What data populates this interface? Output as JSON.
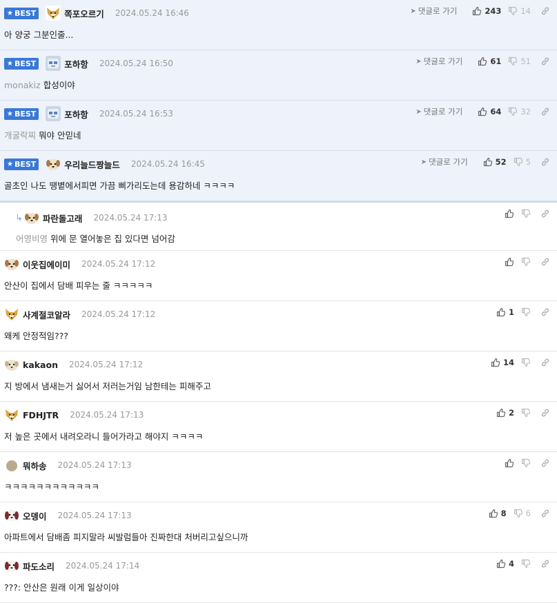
{
  "best_label": "BEST",
  "goto_label": "댓글로 가기",
  "comments": [
    {
      "nick": "쪽포오르기",
      "date": "2024.05.24 16:46",
      "prefix": "",
      "text": "아 양궁 그분인줄...",
      "up": "243",
      "down": "14",
      "best": true,
      "avatar": "fox"
    },
    {
      "nick": "포하항",
      "date": "2024.05.24 16:50",
      "prefix": "monakiz",
      "text": "합성이야",
      "up": "61",
      "down": "51",
      "best": true,
      "avatar": "robot"
    },
    {
      "nick": "포하항",
      "date": "2024.05.24 16:53",
      "prefix": "개굴락찌",
      "text": "뭐야 안믿네",
      "up": "64",
      "down": "32",
      "best": true,
      "avatar": "robot"
    },
    {
      "nick": "우리늘드짱늘드",
      "date": "2024.05.24 16:45",
      "prefix": "",
      "text": "골초인 나도 땡볕에서피면 가끔 삐가리도는데 용감하네 ㅋㅋㅋㅋ",
      "up": "52",
      "down": "5",
      "best": true,
      "avatar": "dog"
    },
    {
      "nick": "파란돌고래",
      "date": "2024.05.24 17:13",
      "prefix": "어영비영",
      "text": "위에 문 열어놓은 집 있다면 넘어감",
      "up": "",
      "down": "",
      "best": false,
      "reply": true,
      "avatar": "dog"
    },
    {
      "nick": "이웃집에이미",
      "date": "2024.05.24 17:12",
      "prefix": "",
      "text": "안산이 집에서 담배 피우는 줄 ㅋㅋㅋㅋㅋ",
      "up": "",
      "down": "",
      "best": false,
      "avatar": "dog"
    },
    {
      "nick": "사계절코알라",
      "date": "2024.05.24 17:12",
      "prefix": "",
      "text": "왜케 안정적임???",
      "up": "1",
      "down": "",
      "best": false,
      "avatar": "fox"
    },
    {
      "nick": "kakaon",
      "date": "2024.05.24 17:12",
      "prefix": "",
      "text": "지 방에서 냄새는거 싫어서 저러는거임 남한테는 피해주고",
      "up": "14",
      "down": "",
      "best": false,
      "avatar": "dog2"
    },
    {
      "nick": "FDHJTR",
      "date": "2024.05.24 17:13",
      "prefix": "",
      "text": "저 높은 곳에서 내려오라니 들어가라고 해야지 ㅋㅋㅋㅋ",
      "up": "2",
      "down": "",
      "best": false,
      "avatar": "fox"
    },
    {
      "nick": "뭐하송",
      "date": "2024.05.24 17:13",
      "prefix": "",
      "text": "ㅋㅋㅋㅋㅋㅋㅋㅋㅋㅋㅋㅋ",
      "up": "",
      "down": "",
      "best": false,
      "avatar": "dot"
    },
    {
      "nick": "오뎅이",
      "date": "2024.05.24 17:13",
      "prefix": "",
      "text": "아파트에서 담배좀 피지말라 씨발럼들아 진짜한대 처버리고싶으니까",
      "up": "8",
      "down": "6",
      "best": false,
      "avatar": "puppy"
    },
    {
      "nick": "파도소리",
      "date": "2024.05.24 17:14",
      "prefix": "",
      "text": "???: 안산은 원래 이게 일상이야",
      "up": "4",
      "down": "",
      "best": false,
      "avatar": "puppy"
    }
  ]
}
